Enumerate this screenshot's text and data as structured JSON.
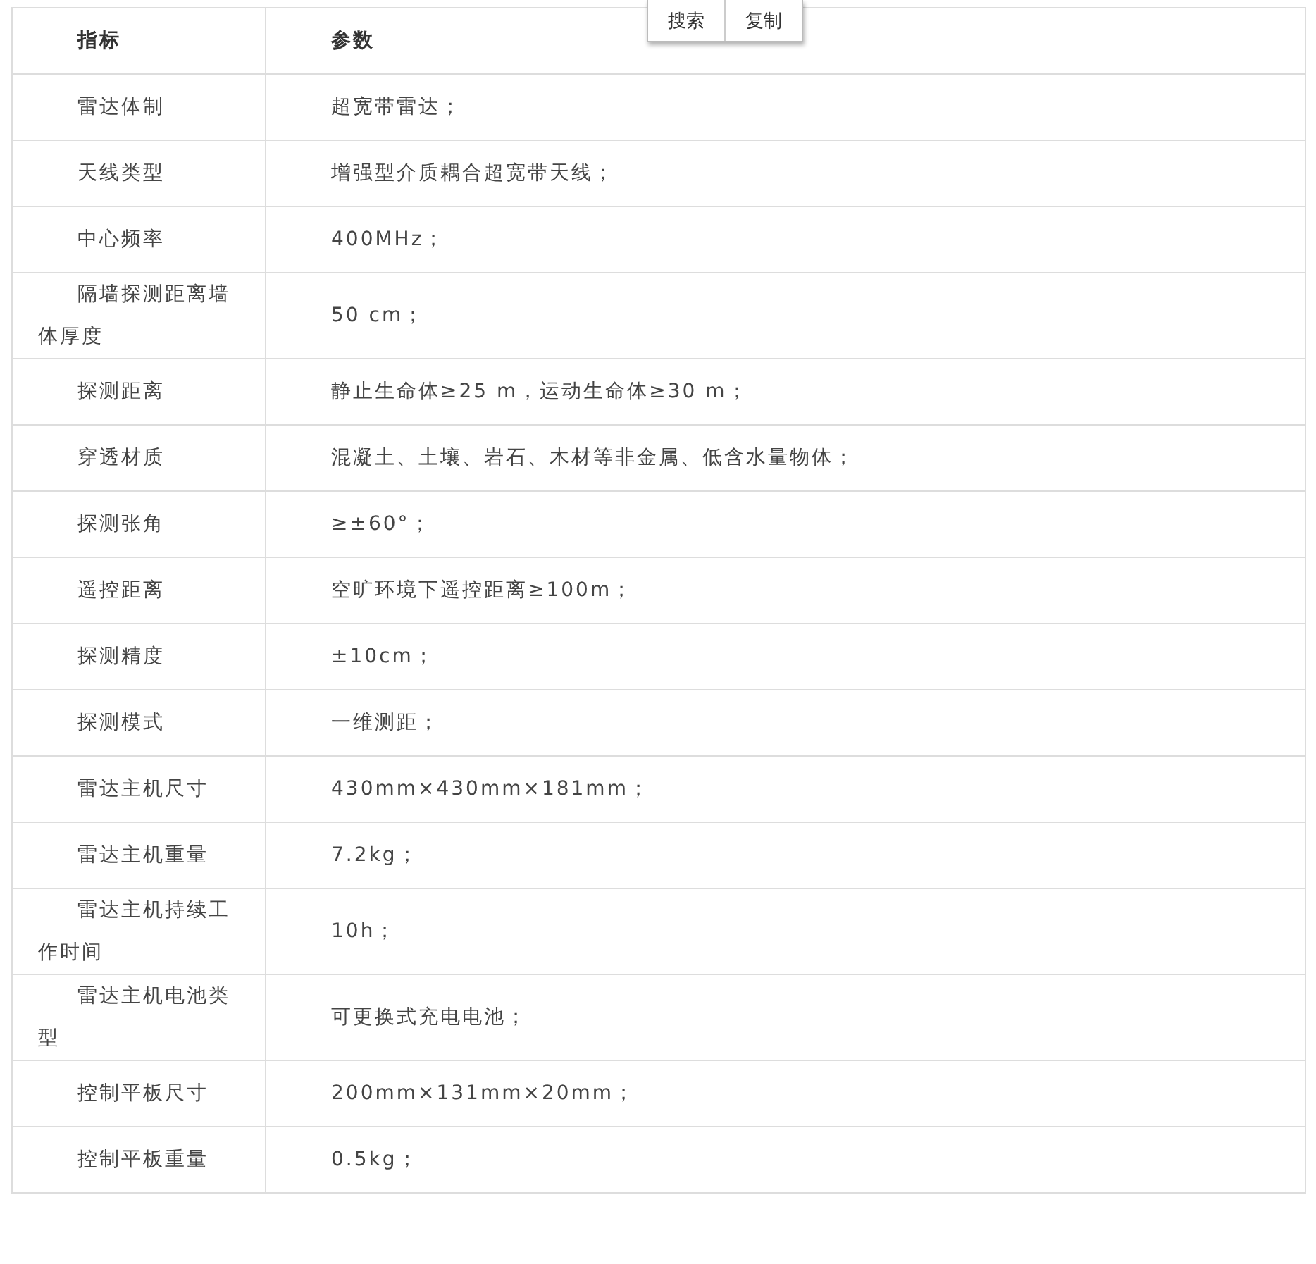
{
  "table": {
    "columns": [
      "指标",
      "参数"
    ],
    "rows": [
      {
        "indicator": "雷达体制",
        "parameter": "超宽带雷达；"
      },
      {
        "indicator": "天线类型",
        "parameter": "增强型介质耦合超宽带天线；"
      },
      {
        "indicator": "中心频率",
        "parameter": "400MHz；"
      },
      {
        "indicator": "隔墙探测距离墙体厚度",
        "parameter": "50 cm；"
      },
      {
        "indicator": "探测距离",
        "parameter": "静止生命体≥25 m，运动生命体≥30 m；"
      },
      {
        "indicator": "穿透材质",
        "parameter": "混凝土、土壤、岩石、木材等非金属、低含水量物体；"
      },
      {
        "indicator": "探测张角",
        "parameter": "≥±60°；"
      },
      {
        "indicator": "遥控距离",
        "parameter": "空旷环境下遥控距离≥100m；"
      },
      {
        "indicator": "探测精度",
        "parameter": "±10cm；"
      },
      {
        "indicator": "探测模式",
        "parameter": "一维测距；"
      },
      {
        "indicator": "雷达主机尺寸",
        "parameter": "430mm×430mm×181mm；"
      },
      {
        "indicator": "雷达主机重量",
        "parameter": "7.2kg；"
      },
      {
        "indicator": "雷达主机持续工作时间",
        "parameter": "10h；"
      },
      {
        "indicator": "雷达主机电池类型",
        "parameter": "可更换式充电电池；"
      },
      {
        "indicator": "控制平板尺寸",
        "parameter": "200mm×131mm×20mm；"
      },
      {
        "indicator": "控制平板重量",
        "parameter": "0.5kg；"
      }
    ]
  },
  "popup": {
    "buttons": [
      "搜索",
      "复制"
    ]
  }
}
